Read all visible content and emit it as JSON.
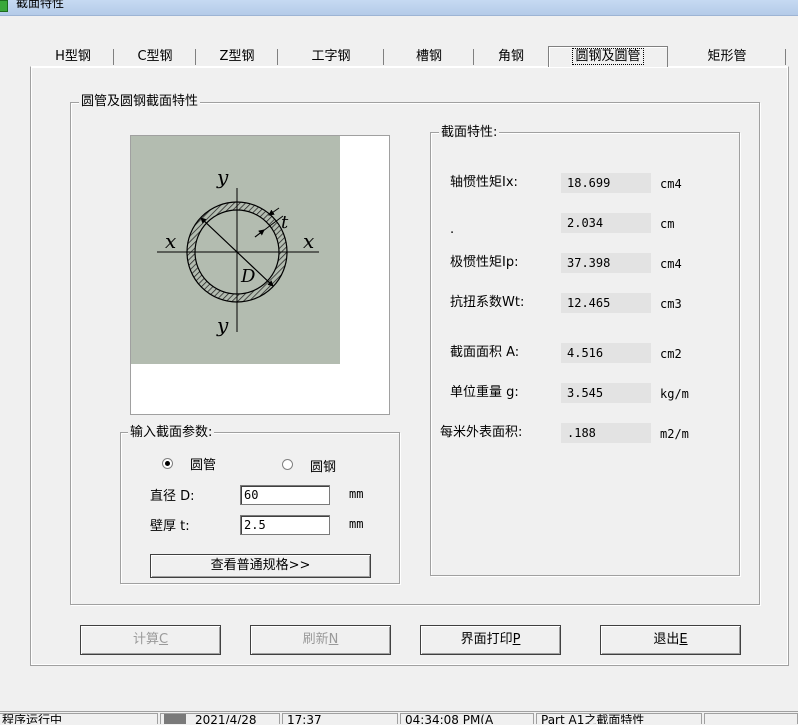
{
  "window": {
    "title": "截面特性"
  },
  "tabs": [
    "H型钢",
    "C型钢",
    "Z型钢",
    "工字钢",
    "槽钢",
    "角钢",
    "圆钢及圆管",
    "矩形管"
  ],
  "main_group": {
    "label": "圆管及圆钢截面特性"
  },
  "figure": {
    "y_top": "y",
    "y_bottom": "y",
    "x_left": "x",
    "x_right": "x",
    "t": "t",
    "d": "D"
  },
  "input_group": {
    "label": "输入截面参数:",
    "radio_pipe": "圆管",
    "radio_bar": "圆钢",
    "diameter_label": "直径 D:",
    "diameter_value": "60",
    "diameter_unit": "mm",
    "thickness_label": "壁厚 t:",
    "thickness_value": "2.5",
    "thickness_unit": "mm",
    "spec_button": "查看普通规格>>"
  },
  "props_group": {
    "label": "截面特性:",
    "rows": [
      {
        "label": "轴惯性矩Ix:",
        "value": "18.699",
        "unit": "cm4"
      },
      {
        "label": ".",
        "value": "2.034",
        "unit": "cm"
      },
      {
        "label": "极惯性矩Ip:",
        "value": "37.398",
        "unit": "cm4"
      },
      {
        "label": "抗扭系数Wt:",
        "value": "12.465",
        "unit": "cm3"
      },
      {
        "label": "截面面积 A:",
        "value": "4.516",
        "unit": "cm2"
      },
      {
        "label": "单位重量 g:",
        "value": "3.545",
        "unit": "kg/m"
      },
      {
        "label": "每米外表面积:",
        "value": ".188",
        "unit": "m2/m"
      }
    ]
  },
  "buttons": {
    "calc": "计算",
    "calc_key": "C",
    "refresh": "刷新",
    "refresh_key": "N",
    "print": "界面打印",
    "print_key": "P",
    "exit": "退出",
    "exit_key": "E"
  },
  "statusbar": {
    "cells": [
      "程序运行中",
      "2021/4/28",
      "17:37",
      "04:34:08 PM(A",
      "Part A1之截面特性"
    ]
  }
}
